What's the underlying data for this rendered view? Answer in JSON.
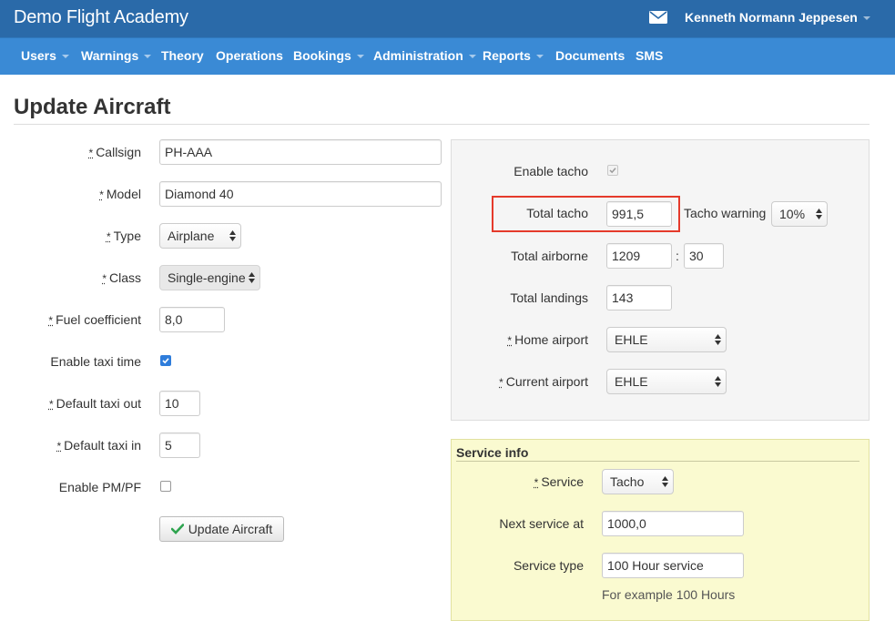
{
  "header": {
    "brand": "Demo Flight Academy",
    "user_name": "Kenneth Normann Jeppesen",
    "mail_icon": "envelope-icon"
  },
  "nav": {
    "users": "Users",
    "warnings": "Warnings",
    "theory": "Theory",
    "operations": "Operations",
    "bookings": "Bookings",
    "administration": "Administration",
    "reports": "Reports",
    "documents": "Documents",
    "sms": "SMS"
  },
  "page": {
    "title": "Update Aircraft"
  },
  "required_marker": "*",
  "form_left": {
    "callsign_label": "Callsign",
    "callsign_value": "PH-AAA",
    "model_label": "Model",
    "model_value": "Diamond 40",
    "type_label": "Type",
    "type_value": "Airplane",
    "class_label": "Class",
    "class_value": "Single-engine",
    "fuel_label": "Fuel coefficient",
    "fuel_value": "8,0",
    "taxi_time_label": "Enable taxi time",
    "taxi_time_checked": true,
    "taxi_out_label": "Default taxi out",
    "taxi_out_value": "10",
    "taxi_in_label": "Default taxi in",
    "taxi_in_value": "5",
    "pm_pf_label": "Enable PM/PF",
    "pm_pf_checked": false,
    "submit_label": "Update Aircraft"
  },
  "form_right": {
    "enable_tacho_label": "Enable tacho",
    "enable_tacho_checked": true,
    "total_tacho_label": "Total tacho",
    "total_tacho_value": "991,5",
    "tacho_warning_label": "Tacho warning",
    "tacho_warning_value": "10%",
    "total_airborne_label": "Total airborne",
    "total_airborne_hours": "1209",
    "total_airborne_separator": ":",
    "total_airborne_minutes": "30",
    "total_landings_label": "Total landings",
    "total_landings_value": "143",
    "home_airport_label": "Home airport",
    "home_airport_value": "EHLE",
    "current_airport_label": "Current airport",
    "current_airport_value": "EHLE"
  },
  "service": {
    "title": "Service info",
    "service_label": "Service",
    "service_value": "Tacho",
    "next_service_label": "Next service at",
    "next_service_value": "1000,0",
    "service_type_label": "Service type",
    "service_type_value": "100 Hour service",
    "service_type_help": "For example 100 Hours"
  },
  "colors": {
    "topbar": "#2a6aa9",
    "navbar": "#3a8ad5",
    "highlight": "#e53a2b",
    "service_panel": "#fafad0"
  }
}
